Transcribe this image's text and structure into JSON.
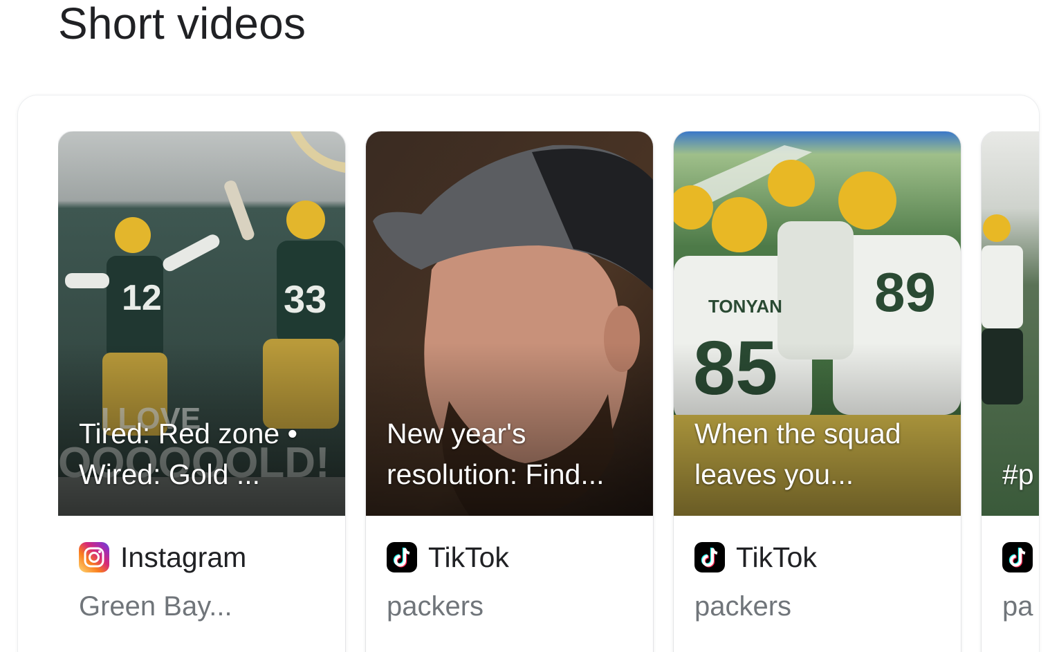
{
  "section": {
    "title": "Short videos"
  },
  "videos": [
    {
      "caption": "Tired: Red zone • Wired: Gold ...",
      "source": "Instagram",
      "source_icon": "instagram-icon",
      "author": "Green Bay..."
    },
    {
      "caption": "New year's resolution: Find...",
      "source": "TikTok",
      "source_icon": "tiktok-icon",
      "author": "packers"
    },
    {
      "caption": "When the squad leaves you...",
      "source": "TikTok",
      "source_icon": "tiktok-icon",
      "author": "packers"
    },
    {
      "caption": "#p #g",
      "source": "",
      "source_icon": "tiktok-icon",
      "author": "pa"
    }
  ],
  "colors": {
    "title": "#202124",
    "secondary_text": "#70757a",
    "packers_green": "#203731",
    "packers_gold": "#ffb612"
  }
}
